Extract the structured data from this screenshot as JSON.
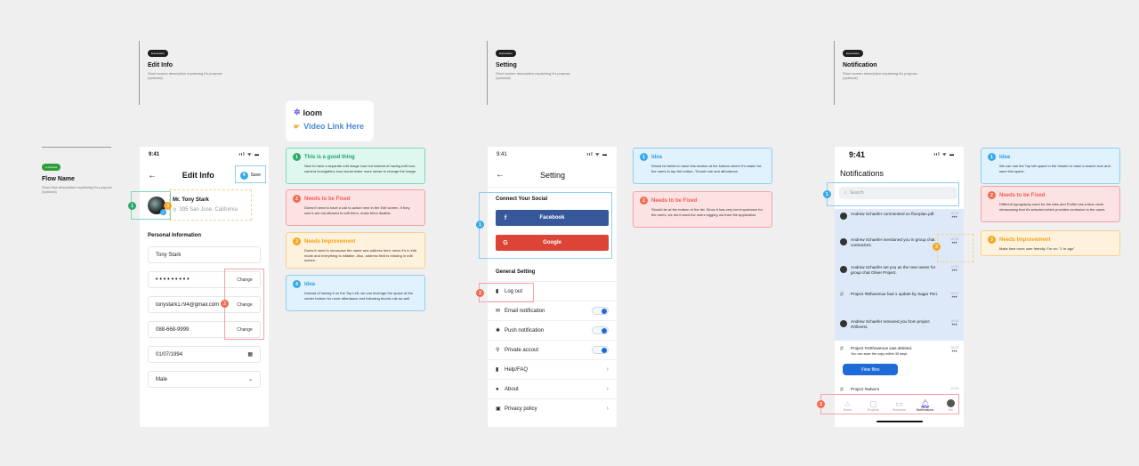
{
  "flow": {
    "badge": "In Review",
    "title": "Flow Name",
    "desc": "Short flow description explaining it's purpose (optional)"
  },
  "sections": [
    {
      "badge": "Exploration",
      "title": "Edit Info",
      "desc": "Short screen description explaining it's purpose (optional)"
    },
    {
      "badge": "Exploration",
      "title": "Setting",
      "desc": "Short screen description explaining it's purpose (optional)"
    },
    {
      "badge": "Exploration",
      "title": "Notification",
      "desc": "Short screen description explaining it's purpose (optional)"
    }
  ],
  "loom": {
    "brand": "loom",
    "link": "Video Link Here"
  },
  "edit": {
    "time": "9:41",
    "signal": "ııl ᯤ ▬",
    "title": "Edit Info",
    "save": "Save",
    "name": "Mr. Tony Stark",
    "address": "395 San Jose, California",
    "section": "Personal Information",
    "fields": [
      "Tony Stark",
      "• • • • • • • • •",
      "tonystark1794@gmail.com",
      "088-668-9999",
      "01/07/1994",
      "Male"
    ],
    "change": "Change"
  },
  "editNotes": [
    {
      "n": "1",
      "title": "This is a good thing",
      "body": "Nice to have a separate edit image icon but instead of having edit icon, camera icon/gallery icon would make more sense to change the image."
    },
    {
      "n": "2",
      "title": "Needs to be Fixed",
      "body": "Doesn't need to have a call to action here in the Edit screen. If they user's are not allowed to edit them, make them disable."
    },
    {
      "n": "3",
      "title": "Needs Improvement",
      "body": "Doesn't need to showcase the name and address here, since it's in edit mode and everything is editable. Also, address field is missing in edit screen."
    },
    {
      "n": "4",
      "title": "Idea",
      "body": "Instead of having it on the Top Left, we can leverage the space at the center bottom for more affordance and following thumb rule as well."
    }
  ],
  "setting": {
    "time": "9:41",
    "signal": "ııl ᯤ ▬",
    "title": "Setting",
    "social": "Connect Your Social",
    "facebook": "Facebook",
    "google": "Google",
    "general": "General Setting",
    "items": [
      {
        "icon": "▮",
        "label": "Log out",
        "ctrl": "none"
      },
      {
        "icon": "✉",
        "label": "Email notification",
        "ctrl": "toggle"
      },
      {
        "icon": "✱",
        "label": "Push notification",
        "ctrl": "toggle"
      },
      {
        "icon": "⚲",
        "label": "Private accout",
        "ctrl": "toggle"
      },
      {
        "icon": "▮",
        "label": "Help/FAQ",
        "ctrl": "chevron"
      },
      {
        "icon": "●",
        "label": "About",
        "ctrl": "chevron"
      },
      {
        "icon": "▣",
        "label": "Privacy policy",
        "ctrl": "chevron"
      }
    ],
    "chevron": "›"
  },
  "settingNotes": [
    {
      "n": "1",
      "title": "Idea",
      "body": "Would be better to have this section at the bottom where it's easier for the users to tap the button- Thumb rule and affordance."
    },
    {
      "n": "2",
      "title": "Needs to be Fixed",
      "body": "Should be at the bottom of the list. Since it has very low importance for the users, we don't want the users logging out from the application."
    }
  ],
  "notif": {
    "time": "9:41",
    "signal": "ııl ᯤ ▬",
    "title": "Notifications",
    "search": "Search",
    "items": [
      {
        "type": "avatar",
        "text": "Andrew Schaefer commented on floorplan.pdf.",
        "time": "16:33"
      },
      {
        "type": "avatar",
        "text": "Andrew Schaefer mentioned you in group chat contractor1.",
        "time": "16:33"
      },
      {
        "type": "avatar",
        "text": "Andrew Schaefer set you as the new owner for group chat Oliver Project.",
        "time": "14:10"
      },
      {
        "type": "hash",
        "text": "Project #5thavenue had 1 update by Sagar Peri.",
        "time": "16:03"
      },
      {
        "type": "avatar",
        "text": "Andrew Schaefer removed you from project #Oliverst.",
        "time": "15:15"
      },
      {
        "type": "hash",
        "text": "Project #10thavenue was deleted.",
        "sub": "You can save the copy within 30 days.",
        "time": "16:03"
      },
      {
        "type": "hash",
        "text": "Project #advent",
        "time": "12:33"
      }
    ],
    "viewFiles": "View files",
    "tabs": [
      "Home",
      "Projects",
      "Schedule",
      "Notifications",
      "Me"
    ],
    "dots": "•••"
  },
  "notifNotes": [
    {
      "n": "1",
      "title": "Idea",
      "body": "We can use the Top left space in the header to have a search icon and save this space."
    },
    {
      "n": "2",
      "title": "Needs to be Fixed",
      "body": "Different typography used for the tabs and Profile has a blue circle showcasing that it's selected which provides confusion to the users."
    },
    {
      "n": "3",
      "title": "Needs Improvement",
      "body": "Make time more user friendly. For ex: \"1 hr ago\""
    }
  ]
}
